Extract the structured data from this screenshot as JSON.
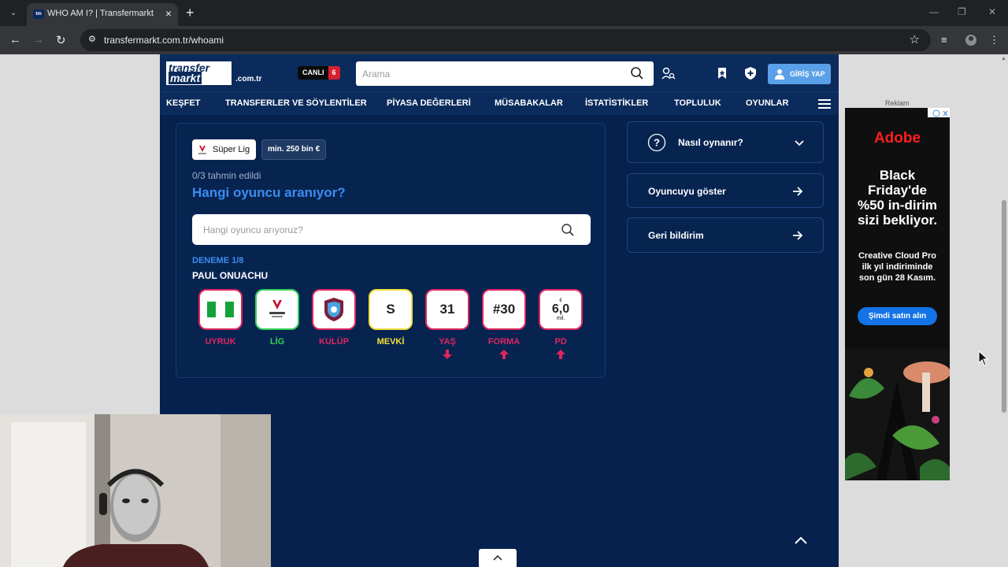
{
  "browser": {
    "tab_title": "WHO AM I? | Transfermarkt",
    "tab_favicon": "tm",
    "url": "transfermarkt.com.tr/whoami"
  },
  "header": {
    "logo_top": "transfer",
    "logo_bottom": "markt",
    "domain": ".com.tr",
    "live_label": "CANLI",
    "live_count": "6",
    "search_placeholder": "Arama",
    "login_label": "GİRİŞ YAP"
  },
  "nav": [
    "KEŞFET",
    "TRANSFERLER VE SÖYLENTİLER",
    "PİYASA DEĞERLERİ",
    "MÜSABAKALAR",
    "İSTATİSTİKLER",
    "TOPLULUK",
    "OYUNLAR"
  ],
  "game": {
    "league_chip": "Süper Lig",
    "min_value_chip": "min. 250 bin €",
    "progress": "0/3 tahmin edildi",
    "question": "Hangi oyuncu aranıyor?",
    "input_placeholder": "Hangi oyuncu arıyoruz?",
    "attempt": "DENEME 1/8",
    "player_name": "PAUL ONUACHU",
    "hints": [
      {
        "label": "UYRUK",
        "value": "",
        "icon": "nigeria-flag-icon",
        "status_color": "#e0245e",
        "arrow": ""
      },
      {
        "label": "LİG",
        "value": "",
        "icon": "trendyol-superlig-logo-icon",
        "status_color": "#34d058",
        "arrow": ""
      },
      {
        "label": "KULÜP",
        "value": "",
        "icon": "trabzonspor-crest-icon",
        "status_color": "#e0245e",
        "arrow": ""
      },
      {
        "label": "MEVKİ",
        "value": "S",
        "icon": "",
        "status_color": "#f2e03c",
        "arrow": ""
      },
      {
        "label": "YAŞ",
        "value": "31",
        "icon": "",
        "status_color": "#e0245e",
        "arrow": "down"
      },
      {
        "label": "FORMA",
        "value": "#30",
        "icon": "",
        "status_color": "#e0245e",
        "arrow": "up"
      },
      {
        "label": "PD",
        "value": "6,0",
        "value_prefix": "€",
        "value_unit": "mil.",
        "icon": "",
        "status_color": "#e0245e",
        "arrow": "up"
      }
    ]
  },
  "sidebar": {
    "how_to_play": "Nasıl oynanır?",
    "show_player": "Oyuncuyu göster",
    "feedback": "Geri bildirim"
  },
  "ad": {
    "label": "Reklam",
    "brand": "Adobe",
    "headline": "Black Friday'de %50 in-dirim sizi bekliyor.",
    "body": "Creative Cloud Pro ilk yıl indiriminde son gün 28 Kasım.",
    "cta": "Şimdi satın alın"
  }
}
